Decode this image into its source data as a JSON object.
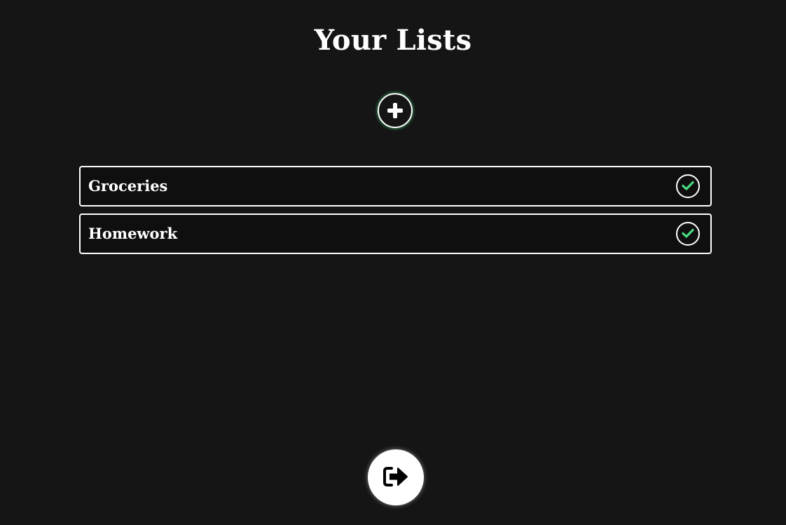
{
  "header": {
    "title": "Your Lists"
  },
  "actions": {
    "add_icon": "plus-icon",
    "logout_icon": "sign-out-icon"
  },
  "lists": [
    {
      "label": "Groceries",
      "status_icon": "check-icon"
    },
    {
      "label": "Homework",
      "status_icon": "check-icon"
    }
  ],
  "colors": {
    "background": "#151515",
    "text": "#ffffff",
    "accent": "#4ade80",
    "border": "#ffffff"
  }
}
